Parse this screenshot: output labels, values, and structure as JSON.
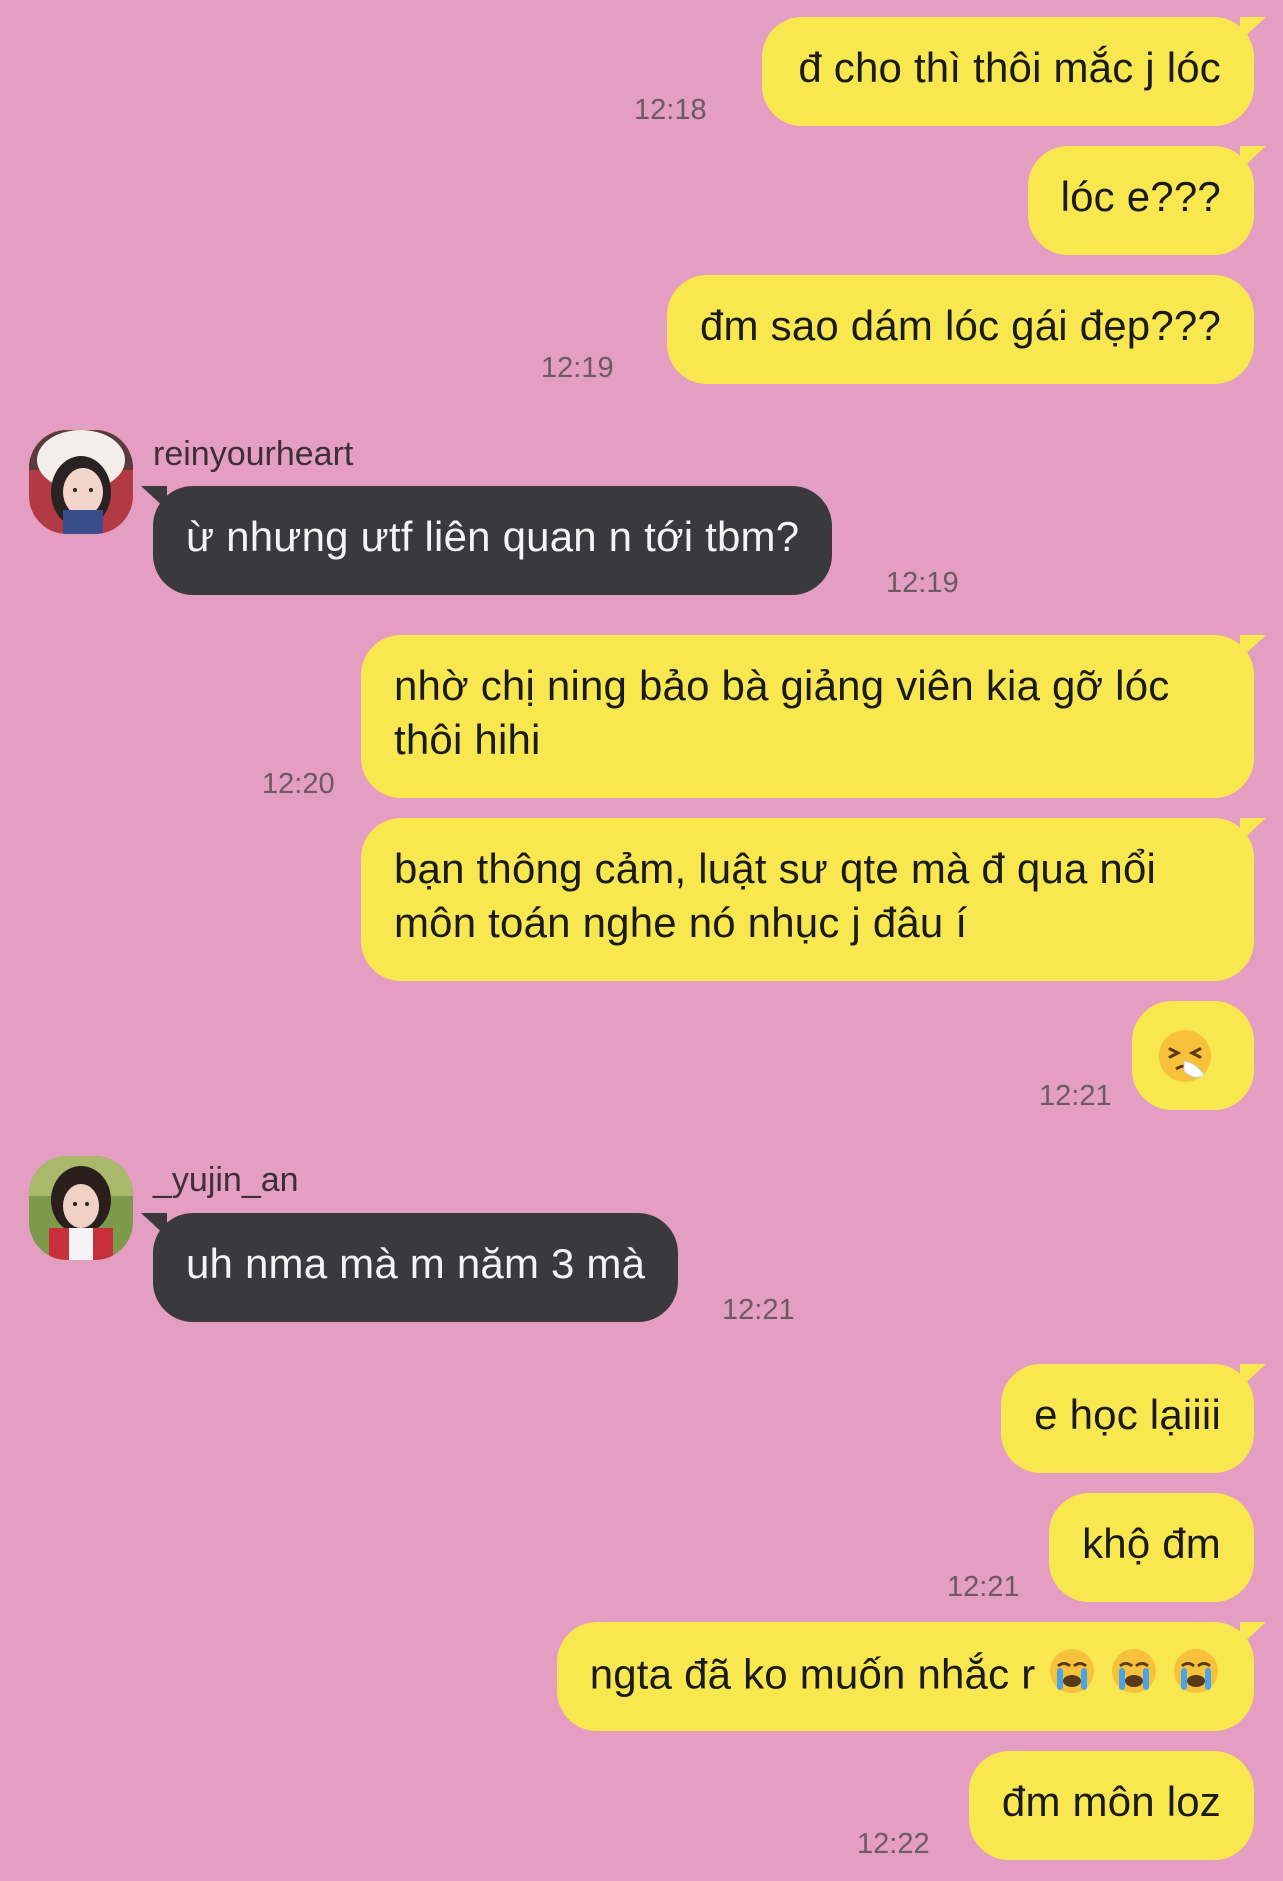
{
  "colors": {
    "background": "#e49ec1",
    "outgoing_bubble": "#f9e74f",
    "incoming_bubble": "#3a393d"
  },
  "messages": [
    {
      "text": "đ cho thì thôi mắc j lóc",
      "time": "12:18"
    },
    {
      "text": "lóc e???"
    },
    {
      "text": "đm sao dám lóc gái đẹp???",
      "time": "12:19"
    },
    {
      "sender": "reinyourheart",
      "text": "ừ nhưng ưtf liên quan n tới tbm?",
      "time": "12:19"
    },
    {
      "line1": "nhờ chị ning bảo bà giảng viên kia gỡ lóc",
      "line2": "thôi hihi",
      "time": "12:20"
    },
    {
      "line1": "bạn thông cảm, luật sư qte mà đ qua nổi",
      "line2": "môn toán nghe nó nhục j đâu í"
    },
    {
      "emoji": "sneezing-face-emoji",
      "time": "12:21"
    },
    {
      "sender": "_yujin_an",
      "text": "uh nma mà m năm 3 mà",
      "time": "12:21"
    },
    {
      "text": "e học lạiiii"
    },
    {
      "text": "khộ đm",
      "time": "12:21"
    },
    {
      "text": "ngta đã ko muốn nhắc r",
      "emoji": "loudly-crying-face-emoji"
    },
    {
      "text": "đm môn loz",
      "time": "12:22"
    }
  ]
}
